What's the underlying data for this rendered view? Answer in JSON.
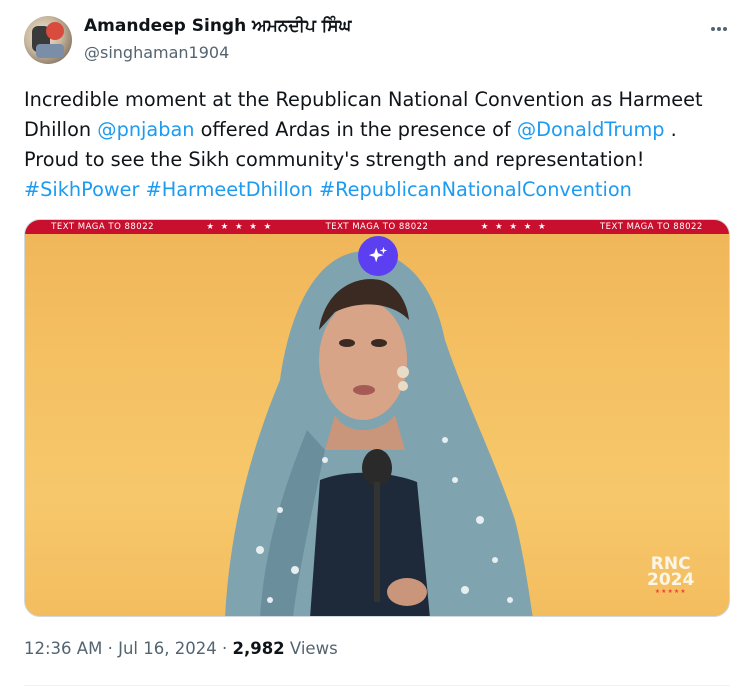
{
  "author": {
    "name": "Amandeep Singh ਅਮਨਦੀਪ ਸਿੰਘ",
    "handle": "@singhaman1904"
  },
  "more_icon": "more-horizontal-icon",
  "tweet": {
    "line1": "Incredible moment at the Republican National Convention as Harmeet",
    "line2_pre": "Dhillon ",
    "mention1": "@pnjaban",
    "line2_mid": " offered Ardas in the presence of ",
    "mention2": "@DonaldTrump",
    "line2_post": " .",
    "line3": "Proud to see the Sikh community's strength and representation!",
    "hashtag1": "#SikhPower",
    "hashtag2": "#HarmeetDhillon",
    "hashtag3": "#RepublicanNationalConvention"
  },
  "media": {
    "banner_segments": [
      "TEXT MAGA TO 88022",
      "★ ★ ★ ★ ★",
      "TEXT MAGA TO 88022",
      "★ ★ ★ ★ ★",
      "TEXT MAGA TO 88022"
    ],
    "logo_line1": "RNC",
    "logo_line2": "2024",
    "ai_badge_icon": "sparkles-icon"
  },
  "meta": {
    "time": "12:36 AM",
    "sep1": " · ",
    "date": "Jul 16, 2024",
    "sep2": " · ",
    "views_count": "2,982",
    "views_label": " Views"
  },
  "colors": {
    "link": "#1d9bf0",
    "secondary_text": "#536471",
    "ai_badge": "#5b3ff0",
    "banner": "#c8102e"
  }
}
